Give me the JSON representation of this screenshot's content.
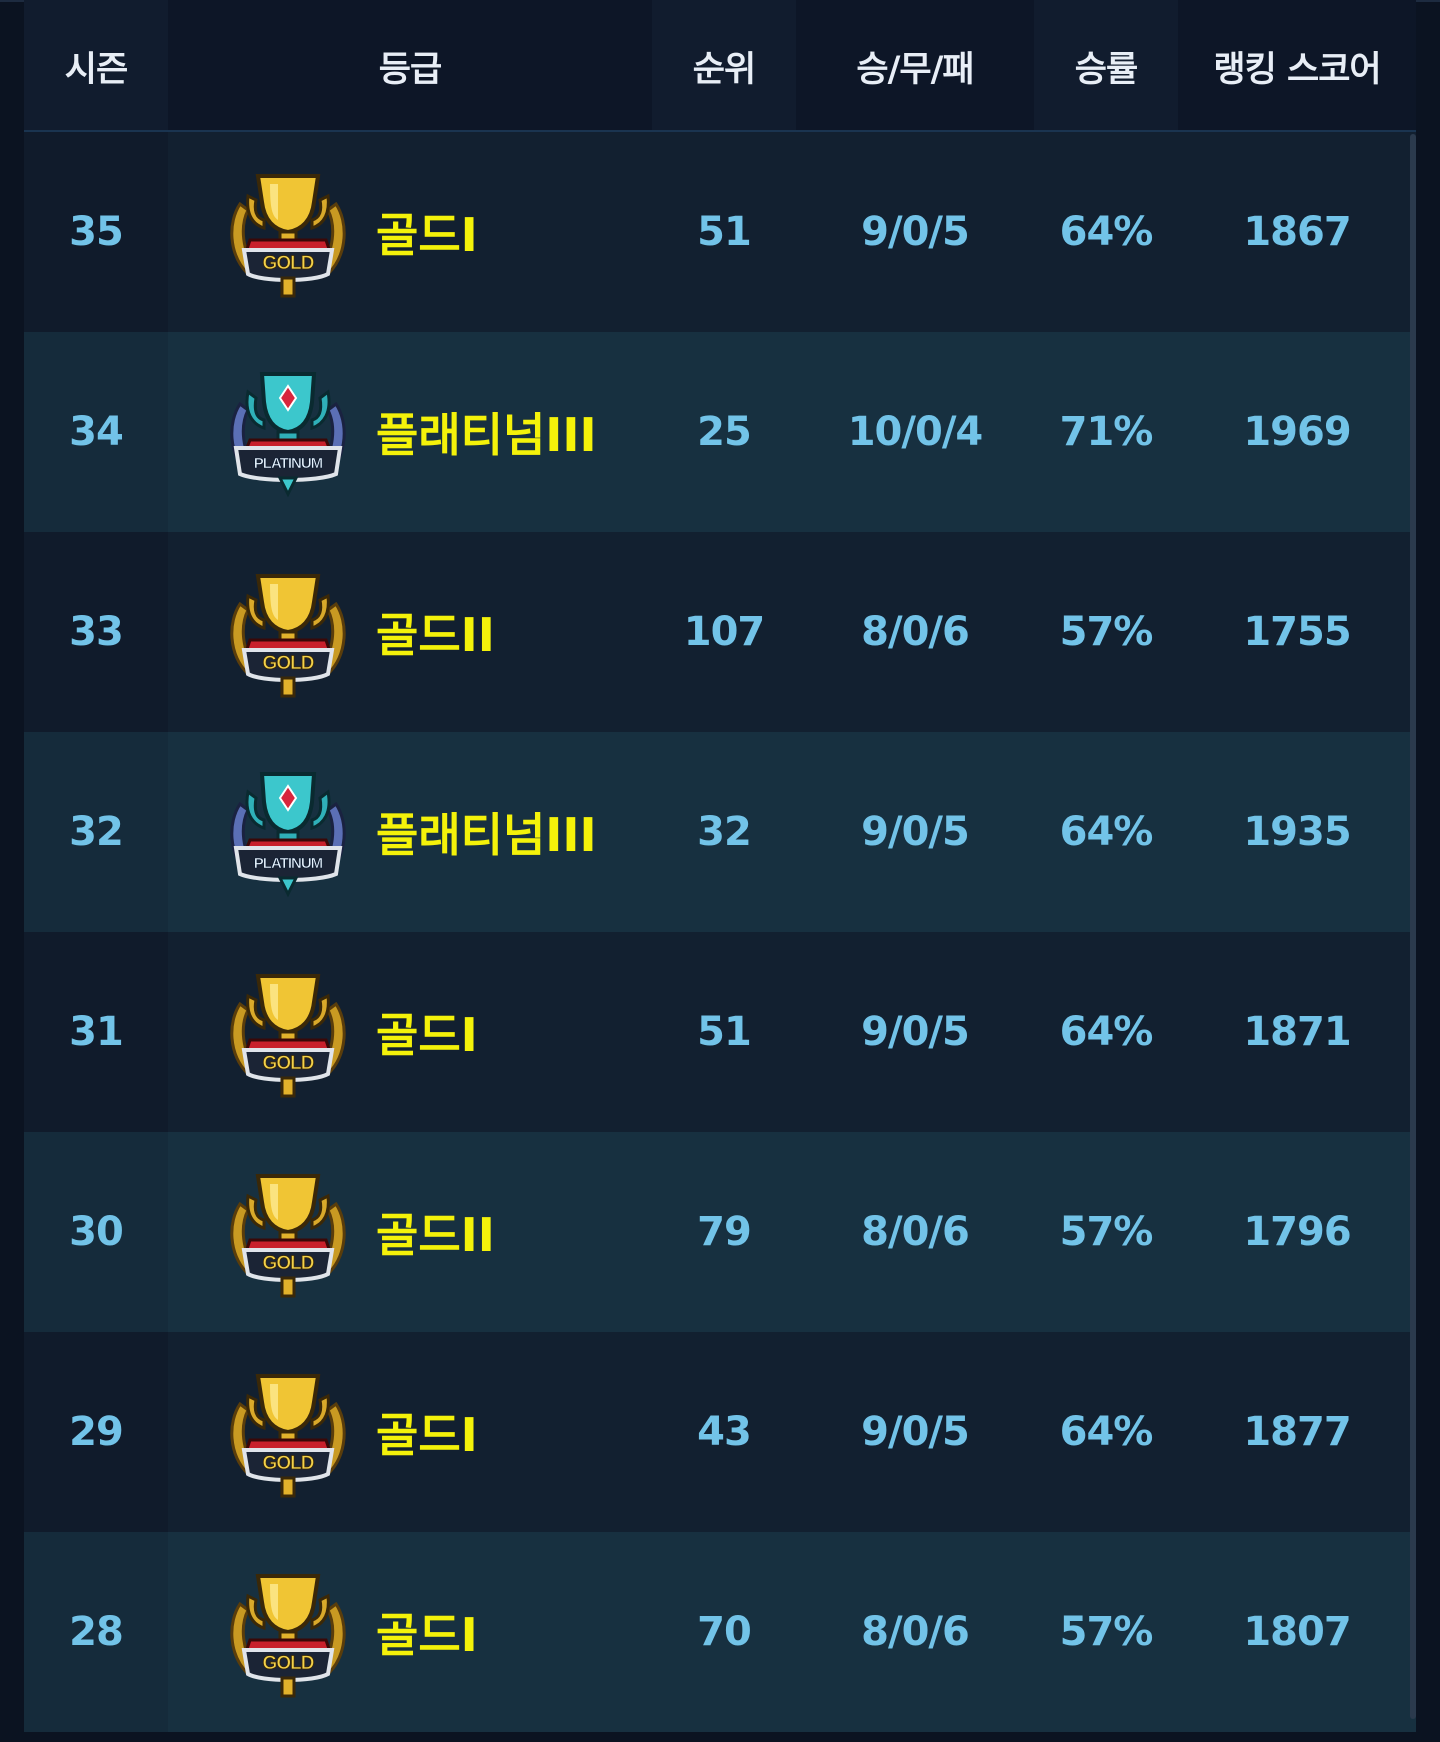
{
  "table": {
    "columns": {
      "season": "시즌",
      "grade": "등급",
      "rank": "순위",
      "wdl": "승/무/패",
      "winrate": "승률",
      "score": "랭킹 스코어"
    },
    "rows": [
      {
        "season": "35",
        "grade": "골드I",
        "tier": "gold",
        "rank": "51",
        "wdl": "9/0/5",
        "winrate": "64%",
        "score": "1867"
      },
      {
        "season": "34",
        "grade": "플래티넘III",
        "tier": "platinum",
        "rank": "25",
        "wdl": "10/0/4",
        "winrate": "71%",
        "score": "1969"
      },
      {
        "season": "33",
        "grade": "골드II",
        "tier": "gold",
        "rank": "107",
        "wdl": "8/0/6",
        "winrate": "57%",
        "score": "1755"
      },
      {
        "season": "32",
        "grade": "플래티넘III",
        "tier": "platinum",
        "rank": "32",
        "wdl": "9/0/5",
        "winrate": "64%",
        "score": "1935"
      },
      {
        "season": "31",
        "grade": "골드I",
        "tier": "gold",
        "rank": "51",
        "wdl": "9/0/5",
        "winrate": "64%",
        "score": "1871"
      },
      {
        "season": "30",
        "grade": "골드II",
        "tier": "gold",
        "rank": "79",
        "wdl": "8/0/6",
        "winrate": "57%",
        "score": "1796"
      },
      {
        "season": "29",
        "grade": "골드I",
        "tier": "gold",
        "rank": "43",
        "wdl": "9/0/5",
        "winrate": "64%",
        "score": "1877"
      },
      {
        "season": "28",
        "grade": "골드I",
        "tier": "gold",
        "rank": "70",
        "wdl": "8/0/6",
        "winrate": "57%",
        "score": "1807"
      }
    ]
  },
  "badges": {
    "gold": {
      "label": "GOLD",
      "icon": "gold-trophy-badge-icon",
      "primary": "#e8b92e",
      "banner": "#1b2435",
      "ribbon": "#c8202c"
    },
    "platinum": {
      "label": "PLATINUM",
      "icon": "platinum-trophy-badge-icon",
      "primary": "#36c3c9",
      "banner": "#1b2435",
      "ribbon": "#c8202c"
    }
  },
  "colors": {
    "grade_text": "#f4f20a",
    "value_text": "#72c3e8",
    "header_text": "#e8eef6"
  }
}
